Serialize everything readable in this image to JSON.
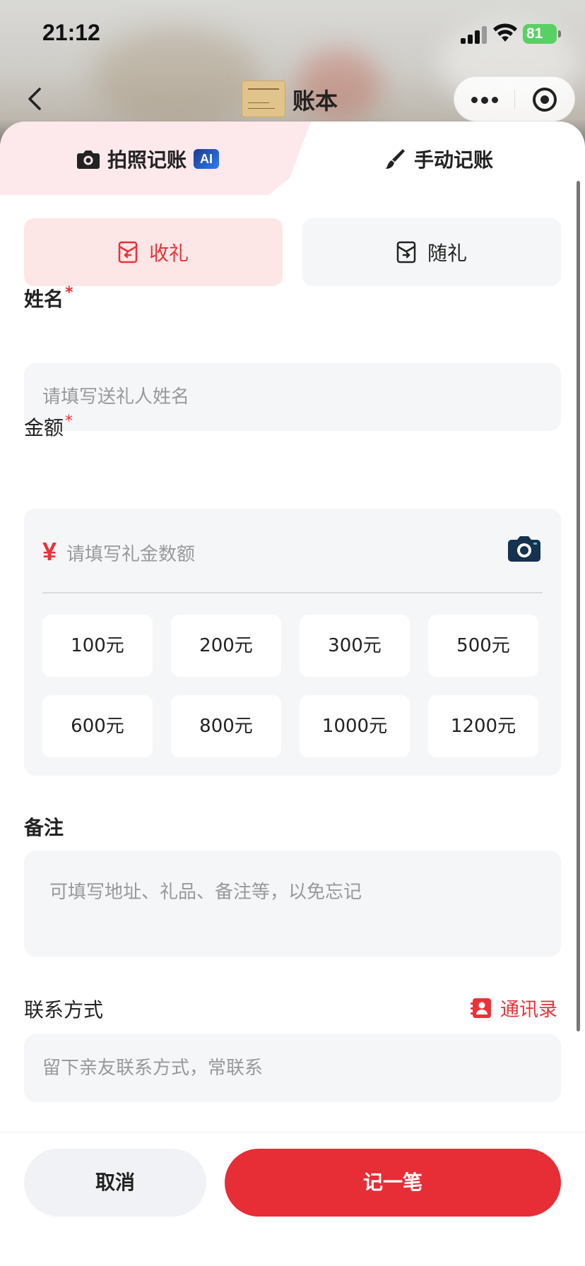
{
  "status_bar": {
    "time": "21:12",
    "battery": "81"
  },
  "nav": {
    "title": "账本"
  },
  "tabs": {
    "photo_label": "拍照记账",
    "ai_badge": "AI",
    "manual_label": "手动记账"
  },
  "type_toggle": {
    "income_label": "收礼",
    "expense_label": "随礼",
    "selected": "收礼"
  },
  "name": {
    "label": "姓名",
    "required_mark": "*",
    "placeholder": "请填写送礼人姓名"
  },
  "amount": {
    "label": "金额",
    "required_mark": "*",
    "currency_symbol": "¥",
    "placeholder": "请填写礼金数额",
    "presets": [
      "100元",
      "200元",
      "300元",
      "500元",
      "600元",
      "800元",
      "1000元",
      "1200元"
    ]
  },
  "note": {
    "label": "备注",
    "placeholder": "可填写地址、礼品、备注等，以免忘记"
  },
  "contact": {
    "label": "联系方式",
    "contacts_link": "通讯录",
    "placeholder": "留下亲友联系方式，常联系"
  },
  "actions": {
    "cancel_label": "取消",
    "submit_label": "记一笔"
  },
  "colors": {
    "accent": "#e72d36",
    "income_bg": "#fde6e6",
    "field_bg": "#f5f6f8"
  }
}
